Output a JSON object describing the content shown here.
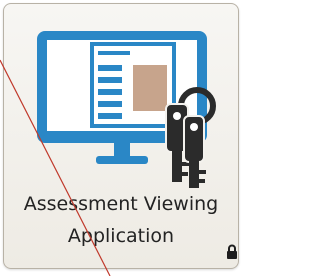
{
  "tile": {
    "label_line1": "Assessment Viewing",
    "label_line2": "Application"
  },
  "icons": {
    "main": "computer-monitor-keys-icon",
    "lock": "lock-icon"
  },
  "colors": {
    "icon_blue": "#2a87c6",
    "document_accent": "#c7a48c",
    "key_dark": "#2b2b2b"
  }
}
